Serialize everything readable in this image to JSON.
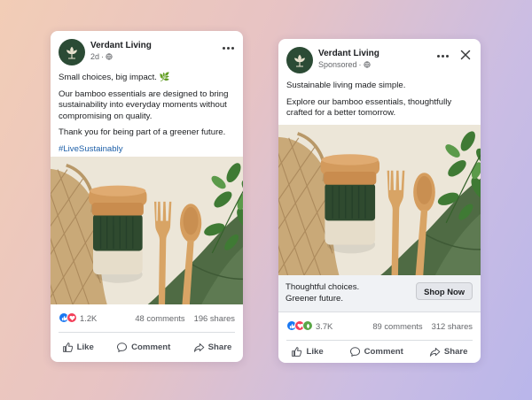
{
  "colors": {
    "brand_green": "#2b4b35",
    "link_blue": "#1d5fa8",
    "like_blue": "#1877f2",
    "love_red": "#f33e58",
    "care_yellow": "#f7b125"
  },
  "post_organic": {
    "brand": "Verdant Living",
    "time": "2d",
    "privacy_icon": "globe-icon",
    "line1": "Small choices, big impact. 🌿",
    "line2": "Our bamboo essentials are designed to bring sustainability into everyday moments without compromising on quality.",
    "line3": "Thank you for being part of a greener future.",
    "hashtag": "#LiveSustainably",
    "reactions": [
      "like",
      "love"
    ],
    "reaction_count": "1.2K",
    "comments": "48 comments",
    "shares": "196 shares",
    "actions": {
      "like": "Like",
      "comment": "Comment",
      "share": "Share"
    }
  },
  "post_ad": {
    "brand": "Verdant Living",
    "sponsored": "Sponsored",
    "privacy_icon": "globe-icon",
    "line1": "Sustainable living made simple.",
    "line2": "Explore our bamboo essentials, thoughtfully crafted for a better tomorrow.",
    "cta_line1": "Thoughtful choices.",
    "cta_line2": "Greener future.",
    "cta_button": "Shop Now",
    "reactions": [
      "like",
      "love",
      "care"
    ],
    "reaction_count": "3.7K",
    "comments": "89 comments",
    "shares": "312 shares",
    "actions": {
      "like": "Like",
      "comment": "Comment",
      "share": "Share"
    }
  }
}
